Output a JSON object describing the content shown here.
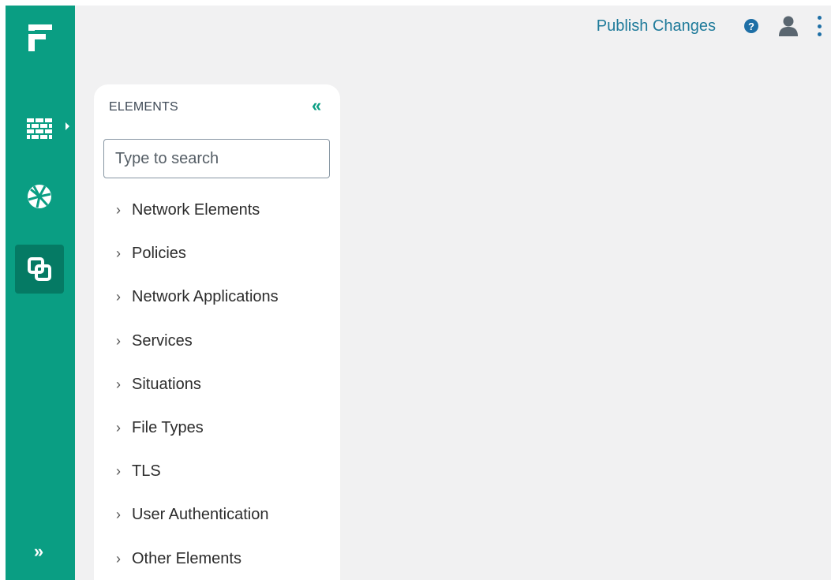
{
  "header": {
    "publish_label": "Publish Changes",
    "help_label": "?",
    "icons": [
      "help-icon",
      "user-icon",
      "more-vertical-icon"
    ],
    "accent_color": "#1e7a9a"
  },
  "rail": {
    "color": "#0a9e83",
    "active_color": "#057a64",
    "items": [
      {
        "icon": "firewall-icon"
      },
      {
        "icon": "network-globe-icon"
      },
      {
        "icon": "elements-icon",
        "active": true
      }
    ],
    "expand_label": "»"
  },
  "panel": {
    "title": "ELEMENTS",
    "collapse_label": "«",
    "search_placeholder": "Type to search",
    "search_value": "",
    "items": [
      {
        "label": "Network Elements"
      },
      {
        "label": "Policies"
      },
      {
        "label": "Network Applications"
      },
      {
        "label": "Services"
      },
      {
        "label": "Situations"
      },
      {
        "label": "File Types"
      },
      {
        "label": "TLS"
      },
      {
        "label": "User Authentication"
      },
      {
        "label": "Other Elements"
      }
    ]
  }
}
